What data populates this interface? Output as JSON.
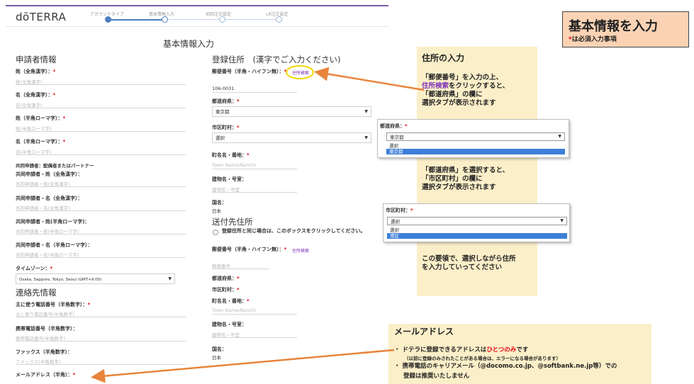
{
  "header": {
    "logo": "dōTERRA",
    "steps": [
      {
        "label": "アカウントタイプ",
        "state": "done"
      },
      {
        "label": "基本情報入力",
        "state": "active"
      },
      {
        "label": "初回注文設定",
        "state": "todo"
      },
      {
        "label": "LR注文設定",
        "state": "todo"
      }
    ]
  },
  "form": {
    "page_title": "基本情報入力",
    "applicant_title": "申請者情報",
    "fields_left": [
      {
        "label": "姓（全角漢字）：",
        "required": "*",
        "placeholder": "姓(全角漢字)"
      },
      {
        "label": "名（全角漢字）：",
        "required": "*",
        "placeholder": "名(全角漢字)"
      },
      {
        "label": "姓（半角ローマ字）：",
        "required": "*",
        "placeholder": "姓(半角ローマ字)"
      },
      {
        "label": "名（半角ローマ字）：",
        "required": "*",
        "placeholder": "名(半角ローマ字)"
      }
    ],
    "co_applicant_note": "共同申請者：配偶者またはパートナー",
    "co_fields": [
      {
        "label": "共同申請者・姓（全角漢字）：",
        "placeholder": "共同申請者・姓(全角漢字)"
      },
      {
        "label": "共同申請者・名（全角漢字）：",
        "placeholder": "共同申請者・名(全角漢字)"
      },
      {
        "label": "共同申請者・姓(半角ローマ字)：",
        "placeholder": "共同申請者・姓(半角ローマ字)"
      },
      {
        "label": "共同申請者・名（半角ローマ字）：",
        "placeholder": "共同申請者・名(半角ローマ字)"
      }
    ],
    "timezone_label": "タイムゾーン：",
    "timezone_required": "*",
    "timezone_value": "Osaka, Sapporo, Tokyo, Seoul (GMT+9:00)",
    "contact_title": "連絡先情報",
    "contact_fields": [
      {
        "label": "主に使う電話番号（半角数字）：",
        "required": "*",
        "placeholder": "主に使う電話番号(半角数字)"
      },
      {
        "label": "携帯電話番号（半角数字）：",
        "required": "",
        "placeholder": "携帯電話番号(半角数字)"
      },
      {
        "label": "ファックス（半角数字）：",
        "required": "",
        "placeholder": "ファックス(半角数字)"
      }
    ],
    "email_label": "メールアドレス（半角）：",
    "email_required": "*",
    "registered_address_title": "登録住所　(漢字でご入力ください)",
    "postal_label": "郵便番号（半角・ハイフン無）：",
    "postal_required": "*",
    "postal_lookup": "住所検索",
    "postal_value": "106-0031",
    "pref_label": "都道府県：",
    "pref_required": "*",
    "pref_value": "東京都",
    "city_label": "市区町村：",
    "city_required": "*",
    "city_value": "選択",
    "street_label": "町名名・番地：",
    "street_required": "*",
    "street_placeholder": "Town Name/Banchi",
    "building_label": "建物名・号室：",
    "building_placeholder": "建物名・号室",
    "country_label": "国名：",
    "country_value": "日本",
    "shipping_title": "送付先住所",
    "same_address_text": "登録住所と同じ場合は、このボックスをクリックしてください。",
    "ship_postal_label": "郵便番号（半角・ハイフン無）：",
    "ship_postal_required": "*",
    "ship_postal_lookup": "住所検索",
    "ship_postal_placeholder": "郵便番号",
    "ship_pref_label": "都道府県：",
    "ship_pref_required": "*",
    "ship_city_label": "市区町村：",
    "ship_city_required": "*",
    "ship_street_label": "町名名・番地：",
    "ship_street_required": "*",
    "ship_street_placeholder": "Town Name/Banchi",
    "ship_building_label": "建物名・号室：",
    "ship_building_placeholder": "建物名・号室",
    "ship_country_label": "国名：",
    "ship_country_value": "日本"
  },
  "annotations": {
    "title_box": {
      "title": "基本情報を入力",
      "star": "*",
      "note": "は必須入力事項"
    },
    "address_box": {
      "title": "住所の入力",
      "line1": "「郵便番号」を入力の上、",
      "line2_link": "住所検索",
      "line2_rest": "をクリックすると、",
      "line3": "「都道府県」の欄に",
      "line4": "選択タブが表示されます",
      "line5": "「都道府県」を選択すると、",
      "line6": "「市区町村」の欄に",
      "line7": "選択タブが表示されます",
      "line8": "この要領で、選択しながら住所",
      "line9": "を入力していってください"
    },
    "pref_popup": {
      "label": "都道府県：",
      "required": "*",
      "value": "東京都",
      "options": [
        "選択",
        "東京都"
      ]
    },
    "city_popup": {
      "label": "市区町村：",
      "required": "*",
      "value": "選択",
      "options": [
        "選択",
        "港区"
      ]
    },
    "email_box": {
      "title": "メールアドレス",
      "b1_pre": "ドテラに登録できるアドレスは",
      "b1_red": "ひとつのみ",
      "b1_post": "です",
      "b1_sub": "（以前に登録のみされたことがある場合は、エラーになる場合があります）",
      "b2_line1": "携帯電話のキャリアメール（@docomo.co.jp、@softbank.ne.jp等）での",
      "b2_line2": "登録は推奨いたしません"
    }
  },
  "colors": {
    "accent_orange": "#e8843a",
    "callout_bg": "#fbefc9",
    "required_red": "#e60012",
    "link_purple": "#7b2fb8",
    "title_box_bg": "#fbd3b4"
  }
}
